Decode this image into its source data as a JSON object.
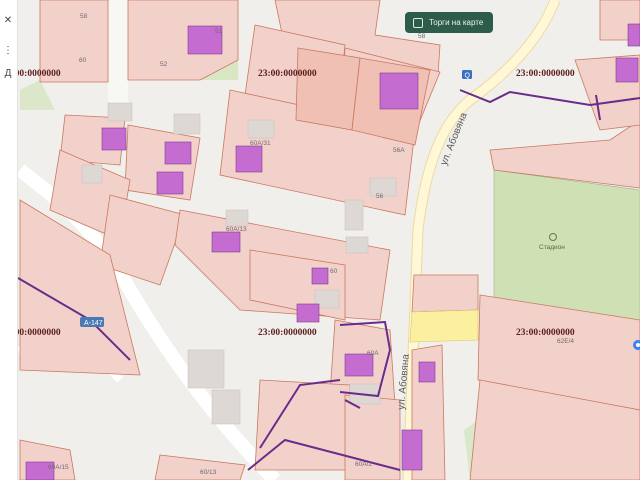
{
  "left_strip": {
    "icons": [
      "close-icon",
      "menu-icon"
    ],
    "text": "Д"
  },
  "map": {
    "cadastral_labels": [
      "23:00:0000000",
      "23:00:0000000",
      "23:00:0000000",
      "23:00:0000000",
      "23:00:0000000",
      "23:00:0000000"
    ],
    "plot_labels": [
      "58",
      "60",
      "52",
      "51",
      "56A",
      "56",
      "60A/31",
      "60A/13",
      "60",
      "60A",
      "60А/2",
      "58",
      "60A/15",
      "60/13",
      "62Е/4"
    ],
    "street_labels": [
      "ул. Абовяна",
      "ул. Абовяна"
    ],
    "road_badge": "А-147",
    "poi_label": "Стадион",
    "search_badge": "Q"
  },
  "toggle": {
    "label": "Торги на карте"
  },
  "colors": {
    "parcel_fill": "#f3d1cb",
    "parcel_border": "#c9785e",
    "building_purple": "#c56cd1",
    "road": "#fff7d6",
    "boundary_purple": "#6a2b8a",
    "green": "#cfe0b4",
    "highlight_yellow": "#fbf0a0"
  }
}
